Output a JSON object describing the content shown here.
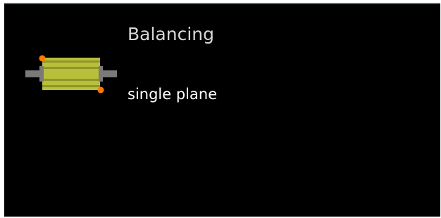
{
  "tile": {
    "title": "Balancing",
    "subtitle": "single plane",
    "icon": "rotor-single-plane-icon",
    "colors": {
      "background": "#000000",
      "top_border": "#2e8b57",
      "title_text": "#d8d8d8",
      "subtitle_text": "#ffffff",
      "rotor_body": "#b8bf3a",
      "shaft": "#6e6e6e",
      "balance_marker": "#ff7a00"
    }
  }
}
